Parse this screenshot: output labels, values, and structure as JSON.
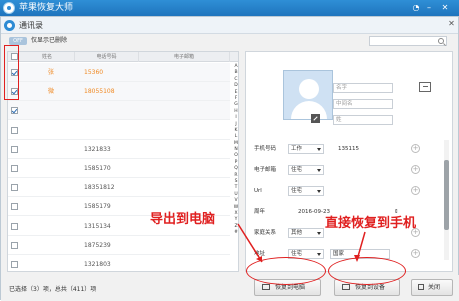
{
  "app": {
    "title": "苹果恢复大师"
  },
  "window": {
    "title": "通讯录"
  },
  "toolbar": {
    "toggle_label": "OFF",
    "show_deleted_label": "仅显示已删除",
    "search_placeholder": ""
  },
  "table": {
    "headers": [
      "姓名",
      "电话号码",
      "电子邮箱"
    ],
    "rows": [
      {
        "name": "张",
        "phone": "15360",
        "checked": true
      },
      {
        "name": "微",
        "phone": "18055108",
        "checked": true
      },
      {
        "name": "",
        "phone": "",
        "checked": true
      },
      {
        "name": "",
        "phone": "",
        "checked": false
      },
      {
        "name": "",
        "phone": "1321833",
        "checked": false
      },
      {
        "name": "",
        "phone": "1585170",
        "checked": false
      },
      {
        "name": "",
        "phone": "18351812",
        "checked": false
      },
      {
        "name": "",
        "phone": "1585179",
        "checked": false
      },
      {
        "name": "",
        "phone": "1315134",
        "checked": false
      },
      {
        "name": "",
        "phone": "1875239",
        "checked": false
      },
      {
        "name": "",
        "phone": "1321803",
        "checked": false
      }
    ],
    "alphabet": [
      "A",
      "B",
      "C",
      "D",
      "E",
      "F",
      "G",
      "H",
      "I",
      "J",
      "K",
      "L",
      "M",
      "N",
      "O",
      "P",
      "Q",
      "R",
      "S",
      "T",
      "U",
      "V",
      "W",
      "X",
      "Y",
      "Z",
      "#"
    ]
  },
  "detail": {
    "name_placeholders": [
      "名字",
      "中间名",
      "姓"
    ],
    "phone_label": "手机号码",
    "phone_type": "工作",
    "phone_value": "135115",
    "email_label": "电子邮箱",
    "email_type": "住宅",
    "url_label": "Url",
    "url_type": "住宅",
    "birthday_label": "周年",
    "birthday_value": "2016-09-23",
    "family_label": "家庭关系",
    "family_type": "其他",
    "address_label": "地址",
    "address_type": "住宅",
    "address_placeholder": "国家"
  },
  "status": {
    "text": "已选择（3）项，总共（411）项"
  },
  "buttons": {
    "export": "恢复到电脑",
    "restore": "恢复到设备",
    "close": "关闭"
  },
  "annotations": {
    "export": "导出到电脑",
    "restore": "直接恢复到手机"
  },
  "colors": {
    "titlebar": "#2b86cd",
    "accent_orange": "#f08a24",
    "annotation_red": "#e02020"
  }
}
